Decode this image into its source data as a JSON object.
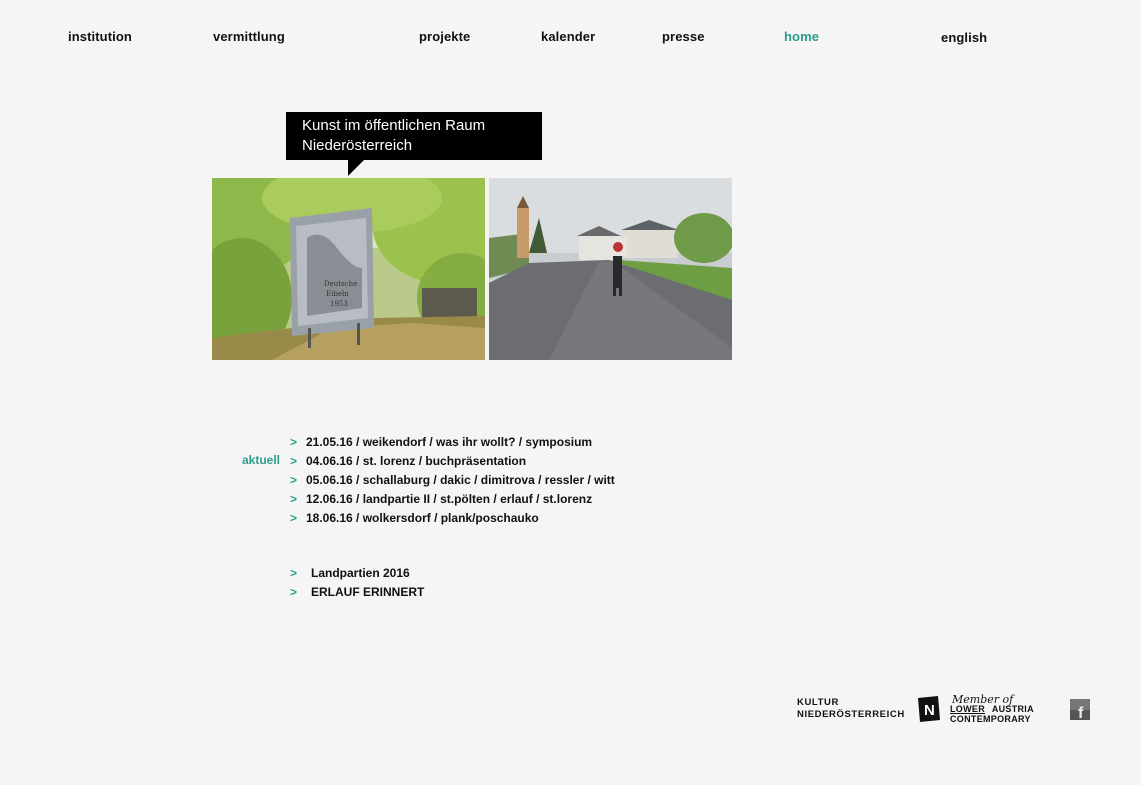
{
  "nav": {
    "items": [
      {
        "label": "institution"
      },
      {
        "label": "vermittlung"
      },
      {
        "label": "projekte"
      },
      {
        "label": "kalender"
      },
      {
        "label": "presse"
      },
      {
        "label": "home"
      },
      {
        "label": "english"
      }
    ],
    "active_color": "#2a9d8a"
  },
  "banner": {
    "line1": "Kunst im öffentlichen Raum",
    "line2": "Niederösterreich"
  },
  "photos": {
    "left_sign_text": [
      "Deutsche",
      "Eibeln",
      "1953"
    ]
  },
  "aktuell": {
    "label": "aktuell",
    "arrow": ">",
    "events": [
      "21.05.16 / weikendorf / was ihr wollt? / symposium",
      "04.06.16 / st. lorenz / buchpräsentation",
      "05.06.16 / schallaburg / dakic / dimitrova / ressler / witt",
      "12.06.16 / landpartie II / st.pölten / erlauf / st.lorenz",
      "18.06.16 / wolkersdorf / plank/poschauko"
    ]
  },
  "projects": {
    "arrow": ">",
    "items": [
      "Landpartien 2016",
      "ERLAUF ERINNERT"
    ]
  },
  "footer": {
    "kultur_line1": "KULTUR",
    "kultur_line2": "NIEDERÖSTERREICH",
    "n_logo": "N",
    "member_of": "Member of",
    "lac_line1a": "LOWER",
    "lac_line1b": "AUSTRIA",
    "lac_line2": "CONTEMPORARY",
    "facebook": "f"
  }
}
